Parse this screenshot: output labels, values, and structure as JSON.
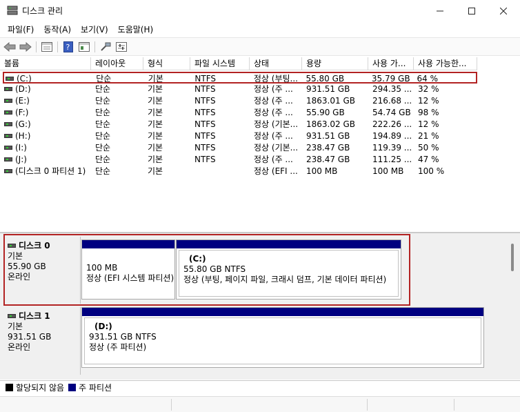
{
  "window": {
    "title": "디스크 관리"
  },
  "menu": [
    "파일(F)",
    "동작(A)",
    "보기(V)",
    "도움말(H)"
  ],
  "toolbar_icons": [
    "back-arrow-icon",
    "forward-arrow-icon",
    "properties-list-icon",
    "help-icon",
    "console-tree-icon",
    "connect-icon",
    "settings-icon"
  ],
  "columns": [
    "볼륨",
    "레이아웃",
    "형식",
    "파일 시스템",
    "상태",
    "용량",
    "사용 가...",
    "사용 가능한..."
  ],
  "volumes": [
    [
      "(C:)",
      "단순",
      "기본",
      "NTFS",
      "정상 (부팅...",
      "55.80 GB",
      "35.79 GB",
      "64 %"
    ],
    [
      "(D:)",
      "단순",
      "기본",
      "NTFS",
      "정상 (주 ...",
      "931.51 GB",
      "294.35 ...",
      "32 %"
    ],
    [
      "(E:)",
      "단순",
      "기본",
      "NTFS",
      "정상 (주 ...",
      "1863.01 GB",
      "216.68 ...",
      "12 %"
    ],
    [
      "(F:)",
      "단순",
      "기본",
      "NTFS",
      "정상 (주 ...",
      "55.90 GB",
      "54.74 GB",
      "98 %"
    ],
    [
      "(G:)",
      "단순",
      "기본",
      "NTFS",
      "정상 (기본...",
      "1863.02 GB",
      "222.26 ...",
      "12 %"
    ],
    [
      "(H:)",
      "단순",
      "기본",
      "NTFS",
      "정상 (주 ...",
      "931.51 GB",
      "194.89 ...",
      "21 %"
    ],
    [
      "(I:)",
      "단순",
      "기본",
      "NTFS",
      "정상 (기본...",
      "238.47 GB",
      "119.39 ...",
      "50 %"
    ],
    [
      "(J:)",
      "단순",
      "기본",
      "NTFS",
      "정상 (주 ...",
      "238.47 GB",
      "111.25 ...",
      "47 %"
    ],
    [
      "(디스크 0 파티션 1)",
      "단순",
      "기본",
      "",
      "정상 (EFI ...",
      "100 MB",
      "100 MB",
      "100 %"
    ]
  ],
  "disks": [
    {
      "name": "디스크 0",
      "type": "기본",
      "size": "55.90 GB",
      "status": "온라인",
      "partitions": [
        {
          "title": "",
          "size": "100 MB",
          "status": "정상 (EFI 시스템 파티션)"
        },
        {
          "title": "(C:)",
          "size": "55.80 GB NTFS",
          "status": "정상 (부팅, 페이지 파일, 크래시 덤프, 기본 데이터 파티션)"
        }
      ]
    },
    {
      "name": "디스크 1",
      "type": "기본",
      "size": "931.51 GB",
      "status": "온라인",
      "partitions": [
        {
          "title": "(D:)",
          "size": "931.51 GB NTFS",
          "status": "정상 (주 파티션)"
        }
      ]
    }
  ],
  "legend": {
    "unallocated": "할당되지 않음",
    "primary": "주 파티션",
    "unallocated_color": "#000000",
    "primary_color": "#000080"
  },
  "highlight_color": "#b22222"
}
